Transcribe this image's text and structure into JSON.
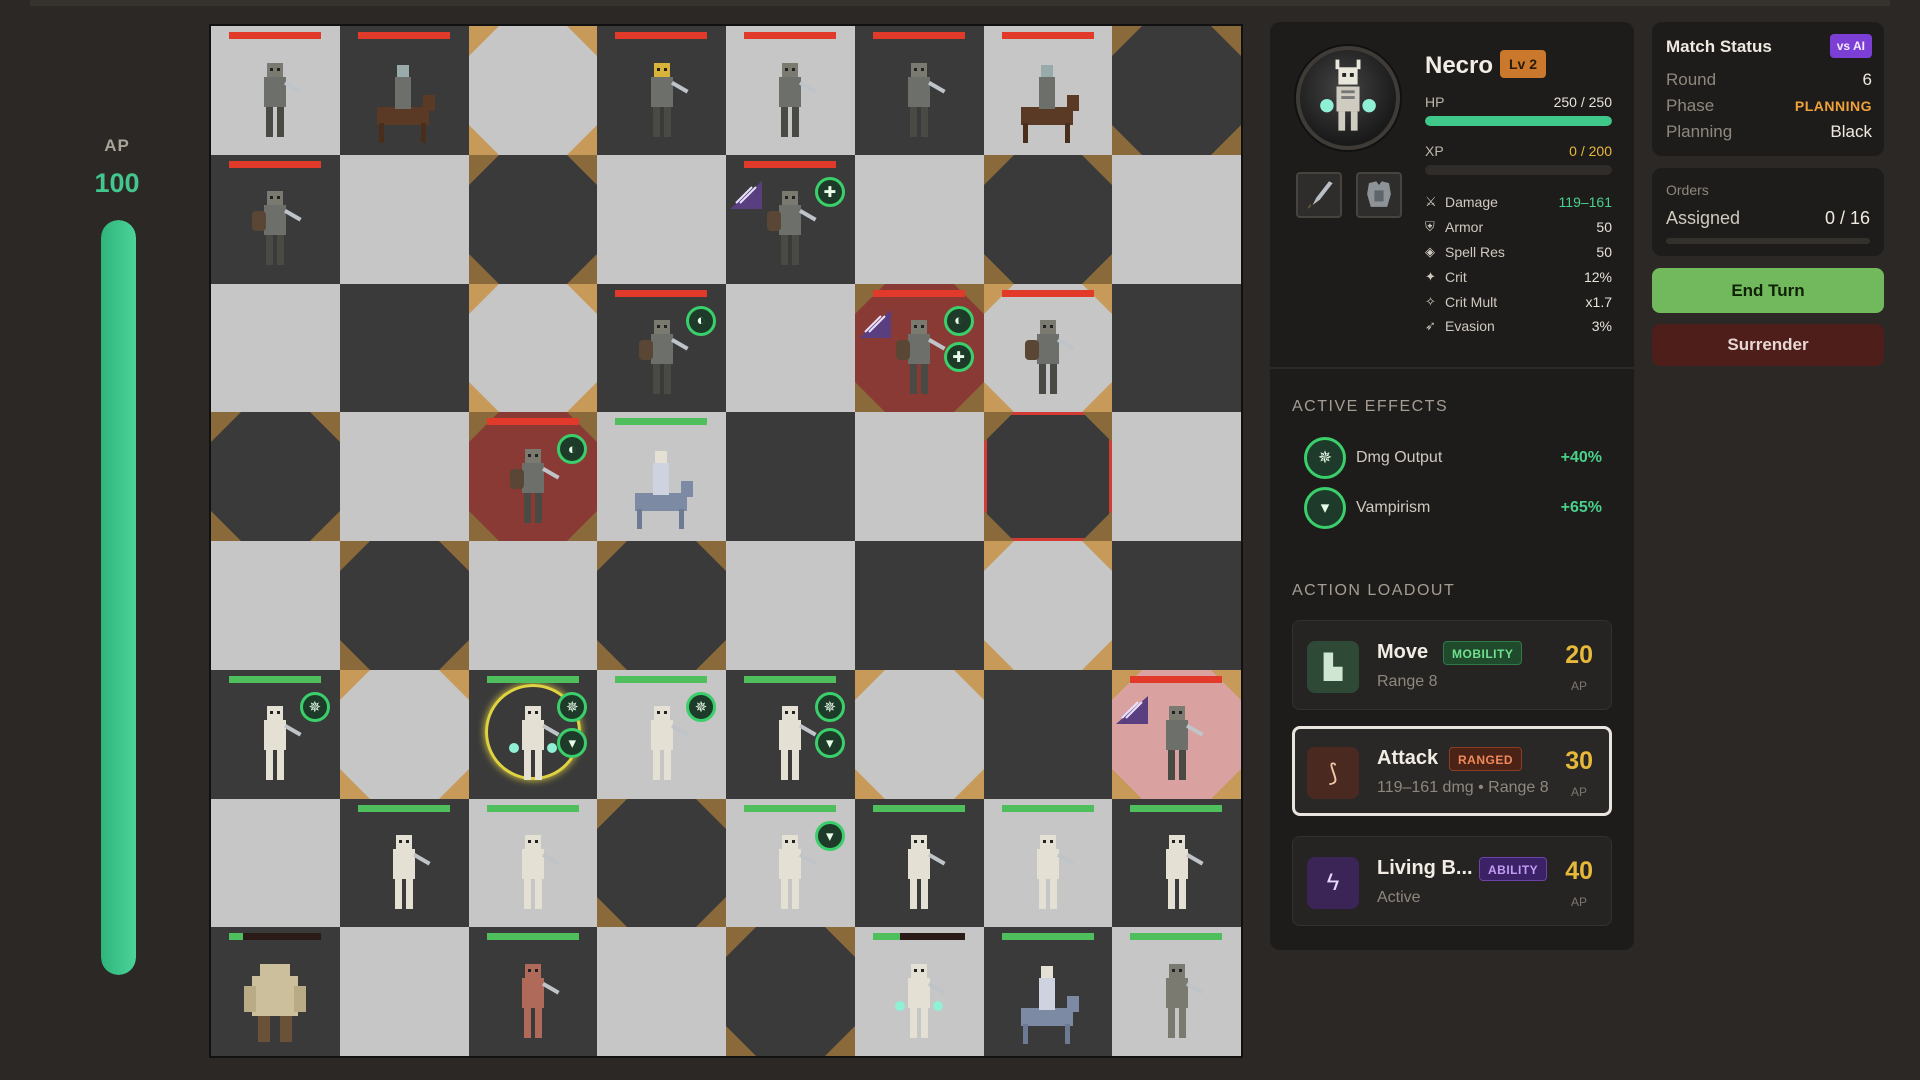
{
  "ap": {
    "label": "AP",
    "value": "100",
    "fill_fraction": 1.0
  },
  "unit_panel": {
    "name": "Necro",
    "level": "Lv 2",
    "hp": {
      "label": "HP",
      "value": "250 / 250",
      "fraction": 1.0
    },
    "xp": {
      "label": "XP",
      "value": "0 / 200",
      "fraction": 0.0
    },
    "stats": [
      {
        "icon": "sword-icon",
        "name": "Damage",
        "value": "119–161"
      },
      {
        "icon": "armor-icon",
        "name": "Armor",
        "value": "50"
      },
      {
        "icon": "shield-icon",
        "name": "Spell Res",
        "value": "50"
      },
      {
        "icon": "crit-icon",
        "name": "Crit",
        "value": "12%"
      },
      {
        "icon": "crit-mult-icon",
        "name": "Crit Mult",
        "value": "x1.7"
      },
      {
        "icon": "evasion-icon",
        "name": "Evasion",
        "value": "3%"
      }
    ],
    "effects_title": "ACTIVE EFFECTS",
    "effects": [
      {
        "icon": "damage-output-icon",
        "name": "Dmg Output",
        "value": "+40%"
      },
      {
        "icon": "vampirism-icon",
        "name": "Vampirism",
        "value": "+65%"
      }
    ],
    "loadout_title": "ACTION LOADOUT",
    "actions": [
      {
        "name": "Move",
        "tag": "MOBILITY",
        "sub": "Range 8",
        "cost": "20",
        "unit": "AP"
      },
      {
        "name": "Attack",
        "tag": "RANGED",
        "sub": "119–161 dmg • Range 8",
        "cost": "30",
        "unit": "AP"
      },
      {
        "name": "Living B...",
        "tag": "ABILITY",
        "sub": "Active",
        "cost": "40",
        "unit": "AP"
      }
    ]
  },
  "match": {
    "title": "Match Status",
    "mode": "vs AI",
    "round_label": "Round",
    "round": "6",
    "phase_label": "Phase",
    "phase": "PLANNING",
    "planning_label": "Planning",
    "planning": "Black"
  },
  "orders": {
    "title": "Orders",
    "label": "Assigned",
    "value": "0 / 16",
    "fraction": 0.0
  },
  "buttons": {
    "end_turn": "End Turn",
    "surrender": "Surrender"
  },
  "colors": {
    "accent_green": "#43c78e",
    "enemy_hp": "#e13a2a",
    "ally_hp": "#4fbf5d",
    "cost_gold": "#e7b93a",
    "end_turn": "#71b95c"
  },
  "board": {
    "rows": 8,
    "cols": 8,
    "units": [
      {
        "r": 0,
        "c": 0,
        "type": "mage-enemy",
        "side": "enemy",
        "hp": 1
      },
      {
        "r": 0,
        "c": 1,
        "type": "knight-rider",
        "side": "enemy",
        "hp": 1
      },
      {
        "r": 0,
        "c": 3,
        "type": "king",
        "side": "enemy",
        "hp": 1
      },
      {
        "r": 0,
        "c": 4,
        "type": "paladin",
        "side": "enemy",
        "hp": 1
      },
      {
        "r": 0,
        "c": 5,
        "type": "spear-knight",
        "side": "enemy",
        "hp": 1
      },
      {
        "r": 0,
        "c": 6,
        "type": "knight-rider",
        "side": "enemy",
        "hp": 1
      },
      {
        "r": 1,
        "c": 0,
        "type": "shield-knight",
        "side": "enemy",
        "hp": 1
      },
      {
        "r": 1,
        "c": 4,
        "type": "shield-knight",
        "side": "enemy",
        "hp": 1,
        "badges": [
          "heal-icon"
        ],
        "debuff": true
      },
      {
        "r": 2,
        "c": 3,
        "type": "shield-knight",
        "side": "enemy",
        "hp": 1,
        "badges": [
          "shield-buff-icon"
        ]
      },
      {
        "r": 2,
        "c": 5,
        "type": "shield-knight",
        "side": "enemy",
        "hp": 1,
        "badges": [
          "shield-buff-icon",
          "heal-icon"
        ],
        "debuff": true
      },
      {
        "r": 2,
        "c": 6,
        "type": "shield-knight",
        "side": "enemy",
        "hp": 1
      },
      {
        "r": 3,
        "c": 2,
        "type": "shield-knight",
        "side": "enemy",
        "hp": 1,
        "badges": [
          "shield-buff-icon"
        ]
      },
      {
        "r": 3,
        "c": 3,
        "type": "reaper-rider",
        "side": "ally",
        "hp": 1
      },
      {
        "r": 5,
        "c": 0,
        "type": "skeleton",
        "side": "ally",
        "hp": 1,
        "badges": [
          "damage-output-icon"
        ]
      },
      {
        "r": 5,
        "c": 2,
        "type": "necro",
        "side": "ally",
        "hp": 1,
        "badges": [
          "damage-output-icon",
          "vampirism-icon"
        ],
        "selected": true
      },
      {
        "r": 5,
        "c": 3,
        "type": "skeleton",
        "side": "ally",
        "hp": 1,
        "badges": [
          "damage-output-icon"
        ]
      },
      {
        "r": 5,
        "c": 4,
        "type": "skeleton",
        "side": "ally",
        "hp": 1,
        "badges": [
          "damage-output-icon",
          "vampirism-icon"
        ]
      },
      {
        "r": 5,
        "c": 7,
        "type": "barbarian",
        "side": "enemy",
        "hp": 1,
        "debuff": true
      },
      {
        "r": 6,
        "c": 1,
        "type": "skeleton",
        "side": "ally",
        "hp": 1
      },
      {
        "r": 6,
        "c": 2,
        "type": "skeleton",
        "side": "ally",
        "hp": 1
      },
      {
        "r": 6,
        "c": 4,
        "type": "skeleton-armored",
        "side": "ally",
        "hp": 1,
        "badges": [
          "vampirism-icon"
        ]
      },
      {
        "r": 6,
        "c": 5,
        "type": "skeleton",
        "side": "ally",
        "hp": 1
      },
      {
        "r": 6,
        "c": 6,
        "type": "skeleton",
        "side": "ally",
        "hp": 1
      },
      {
        "r": 6,
        "c": 7,
        "type": "skeleton",
        "side": "ally",
        "hp": 1
      },
      {
        "r": 7,
        "c": 0,
        "type": "ogre",
        "side": "ally",
        "hp": 0.15
      },
      {
        "r": 7,
        "c": 2,
        "type": "demon",
        "side": "ally",
        "hp": 1
      },
      {
        "r": 7,
        "c": 5,
        "type": "lich",
        "side": "ally",
        "hp": 0.3
      },
      {
        "r": 7,
        "c": 6,
        "type": "reaper-rider",
        "side": "ally",
        "hp": 1
      },
      {
        "r": 7,
        "c": 7,
        "type": "horned-warrior",
        "side": "ally",
        "hp": 1
      }
    ],
    "highlights": [
      {
        "r": 2,
        "c": 5,
        "kind": "red-glow"
      },
      {
        "r": 3,
        "c": 2,
        "kind": "red-glow"
      },
      {
        "r": 3,
        "c": 6,
        "kind": "outline-red"
      },
      {
        "r": 5,
        "c": 7,
        "kind": "red-glow"
      }
    ],
    "corner_marked": [
      [
        0,
        2
      ],
      [
        0,
        7
      ],
      [
        1,
        2
      ],
      [
        1,
        6
      ],
      [
        2,
        2
      ],
      [
        2,
        5
      ],
      [
        2,
        6
      ],
      [
        3,
        0
      ],
      [
        3,
        2
      ],
      [
        3,
        6
      ],
      [
        4,
        1
      ],
      [
        4,
        3
      ],
      [
        4,
        6
      ],
      [
        5,
        1
      ],
      [
        5,
        5
      ],
      [
        5,
        7
      ],
      [
        6,
        3
      ],
      [
        7,
        4
      ]
    ]
  }
}
